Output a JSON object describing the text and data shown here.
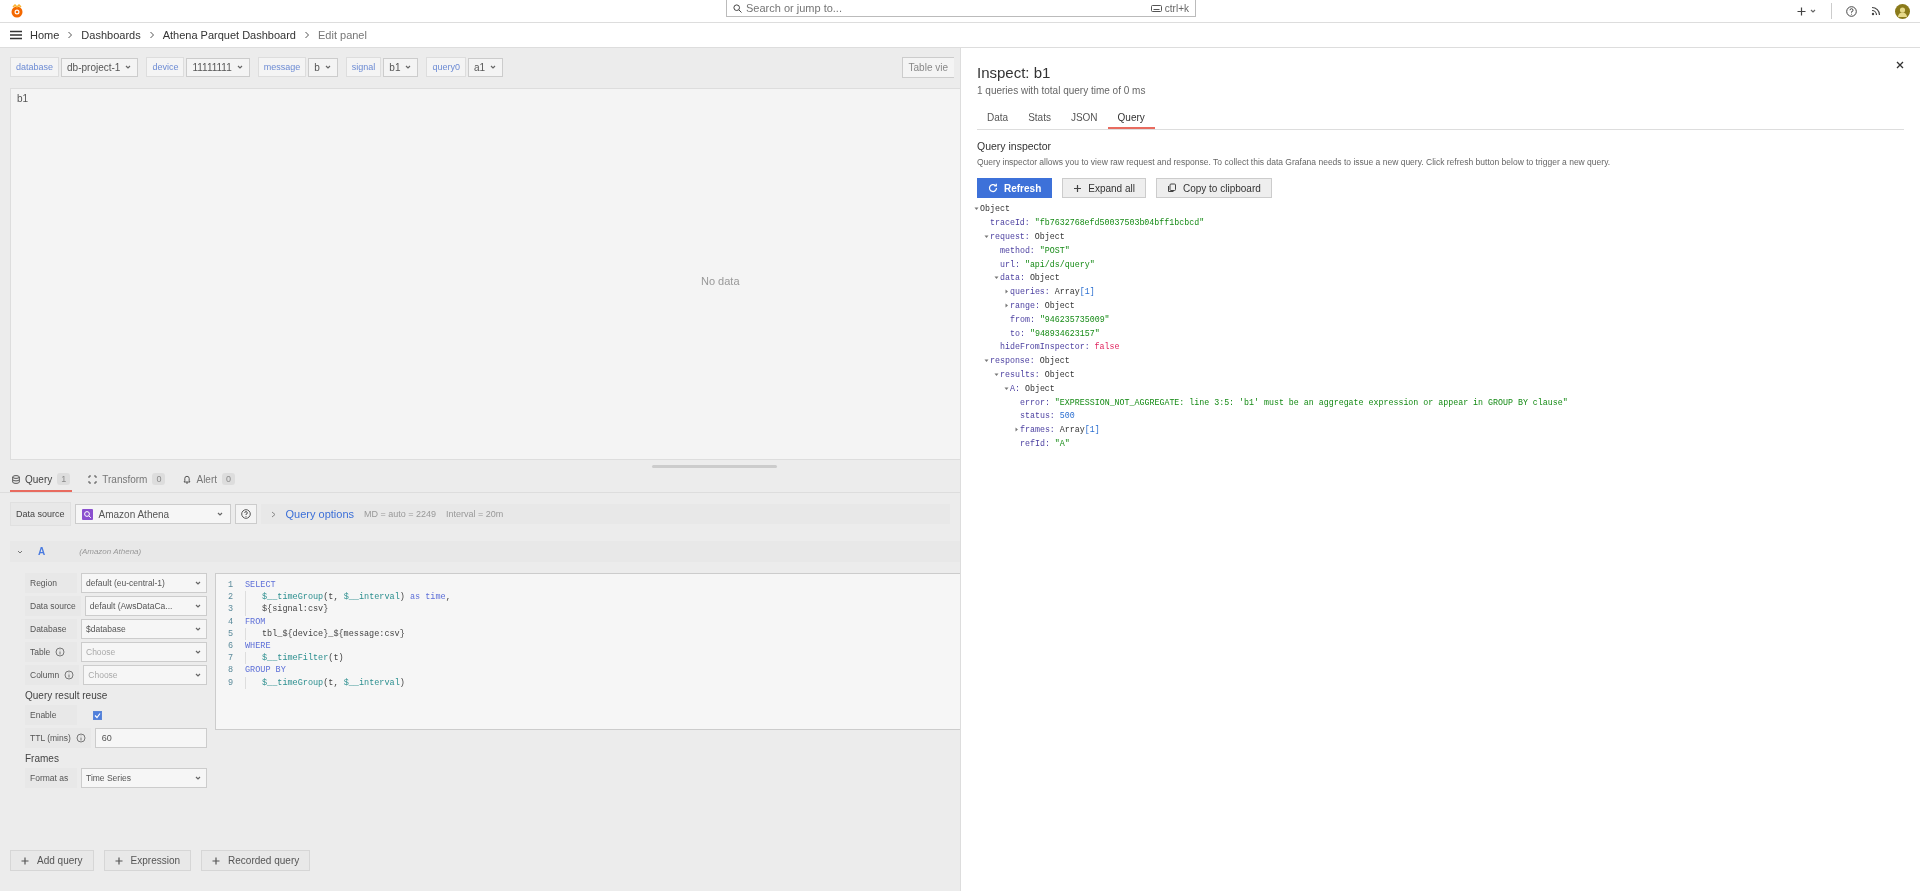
{
  "topbar": {
    "search_placeholder": "Search or jump to...",
    "shortcut": "ctrl+k"
  },
  "breadcrumbs": [
    "Home",
    "Dashboards",
    "Athena Parquet Dashboard",
    "Edit panel"
  ],
  "variables": [
    {
      "label": "database",
      "value": "db-project-1"
    },
    {
      "label": "device",
      "value": "11111111"
    },
    {
      "label": "message",
      "value": "b"
    },
    {
      "label": "signal",
      "value": "b1"
    },
    {
      "label": "query0",
      "value": "a1"
    }
  ],
  "view_toggle": "Table vie",
  "panel": {
    "title": "b1",
    "message": "No data"
  },
  "query_tabs": [
    {
      "label": "Query",
      "count": "1",
      "selected": true
    },
    {
      "label": "Transform",
      "count": "0",
      "selected": false
    },
    {
      "label": "Alert",
      "count": "0",
      "selected": false
    }
  ],
  "data_source": {
    "label": "Data source",
    "value": "Amazon Athena",
    "options_label": "Query options",
    "md": "MD = auto = 2249",
    "interval": "Interval = 20m"
  },
  "query": {
    "name": "A",
    "source": "(Amazon Athena)",
    "expanded": true
  },
  "fields": [
    {
      "kind": "select",
      "label": "Region",
      "value": "default (eu-central-1)"
    },
    {
      "kind": "select",
      "label": "Data source",
      "value": "default (AwsDataCa..."
    },
    {
      "kind": "select",
      "label": "Database",
      "value": "$database"
    },
    {
      "kind": "select",
      "label": "Table",
      "info": true,
      "placeholder": "Choose"
    },
    {
      "kind": "select",
      "label": "Column",
      "info": true,
      "placeholder": "Choose"
    },
    {
      "kind": "heading",
      "label": "Query result reuse"
    },
    {
      "kind": "checkbox",
      "label": "Enable",
      "checked": true
    },
    {
      "kind": "input",
      "label": "TTL (mins)",
      "info": true,
      "value": "60"
    },
    {
      "kind": "heading",
      "label": "Frames"
    },
    {
      "kind": "select",
      "label": "Format as",
      "value": "Time Series"
    }
  ],
  "code": [
    {
      "number": "1",
      "segments": [
        {
          "kind": "keyword",
          "text": "SELECT"
        }
      ]
    },
    {
      "number": "2",
      "indent": true,
      "segments": [
        {
          "kind": "macro",
          "text": "$__timeGroup"
        },
        {
          "kind": "plain",
          "text": "(t, "
        },
        {
          "kind": "macro",
          "text": "$__interval"
        },
        {
          "kind": "plain",
          "text": ") "
        },
        {
          "kind": "keyword",
          "text": "as time"
        },
        {
          "kind": "plain",
          "text": ","
        }
      ]
    },
    {
      "number": "3",
      "indent": true,
      "segments": [
        {
          "kind": "plain",
          "text": "${signal:csv}"
        }
      ]
    },
    {
      "number": "4",
      "segments": [
        {
          "kind": "keyword",
          "text": "FROM"
        }
      ]
    },
    {
      "number": "5",
      "indent": true,
      "segments": [
        {
          "kind": "plain",
          "text": "tbl_${device}_${message:csv}"
        }
      ]
    },
    {
      "number": "6",
      "segments": [
        {
          "kind": "keyword",
          "text": "WHERE"
        }
      ]
    },
    {
      "number": "7",
      "indent": true,
      "segments": [
        {
          "kind": "macro",
          "text": "$__timeFilter"
        },
        {
          "kind": "plain",
          "text": "(t)"
        }
      ]
    },
    {
      "number": "8",
      "segments": [
        {
          "kind": "keyword",
          "text": "GROUP BY"
        }
      ]
    },
    {
      "number": "9",
      "indent": true,
      "segments": [
        {
          "kind": "macro",
          "text": "$__timeGroup"
        },
        {
          "kind": "plain",
          "text": "(t, "
        },
        {
          "kind": "macro",
          "text": "$__interval"
        },
        {
          "kind": "plain",
          "text": ")"
        }
      ]
    }
  ],
  "add_buttons": [
    "Add query",
    "Expression",
    "Recorded query"
  ],
  "drawer": {
    "title": "Inspect: b1",
    "subtitle": "1 queries with total query time of 0 ms",
    "tabs": [
      {
        "label": "Data",
        "selected": false
      },
      {
        "label": "Stats",
        "selected": false
      },
      {
        "label": "JSON",
        "selected": false
      },
      {
        "label": "Query",
        "selected": true
      }
    ],
    "section_title": "Query inspector",
    "description": "Query inspector allows you to view raw request and response. To collect this data Grafana needs to issue a new query. Click refresh button below to trigger a new query.",
    "buttons": [
      {
        "kind": "refresh",
        "label": "Refresh"
      },
      {
        "kind": "expand",
        "label": "Expand all"
      },
      {
        "kind": "copy",
        "label": "Copy to clipboard"
      }
    ],
    "tree": {
      "value": "Object",
      "kind": "object",
      "expanded": true,
      "children": [
        {
          "key": "traceId:",
          "value": "\"fb7632768efd50037503b04bff1bcbcd\"",
          "kind": "string"
        },
        {
          "key": "request:",
          "value": "Object",
          "kind": "object",
          "expanded": true,
          "children": [
            {
              "key": "method:",
              "value": "\"POST\"",
              "kind": "string"
            },
            {
              "key": "url:",
              "value": "\"api/ds/query\"",
              "kind": "string"
            },
            {
              "key": "data:",
              "value": "Object",
              "kind": "object",
              "expanded": true,
              "children": [
                {
                  "key": "queries:",
                  "value": "Array",
                  "count": "[1]",
                  "kind": "object",
                  "expanded": false
                },
                {
                  "key": "range:",
                  "value": "Object",
                  "kind": "object",
                  "expanded": false
                },
                {
                  "key": "from:",
                  "value": "\"946235735009\"",
                  "kind": "string"
                },
                {
                  "key": "to:",
                  "value": "\"948934623157\"",
                  "kind": "string"
                }
              ]
            },
            {
              "key": "hideFromInspector:",
              "value": "false",
              "kind": "boolean"
            }
          ]
        },
        {
          "key": "response:",
          "value": "Object",
          "kind": "object",
          "expanded": true,
          "children": [
            {
              "key": "results:",
              "value": "Object",
              "kind": "object",
              "expanded": true,
              "children": [
                {
                  "key": "A:",
                  "value": "Object",
                  "kind": "object",
                  "expanded": true,
                  "children": [
                    {
                      "key": "error:",
                      "value": "\"EXPRESSION_NOT_AGGREGATE: line 3:5: 'b1' must be an aggregate expression or appear in GROUP BY clause\"",
                      "kind": "string"
                    },
                    {
                      "key": "status:",
                      "value": "500",
                      "kind": "number"
                    },
                    {
                      "key": "frames:",
                      "value": "Array",
                      "count": "[1]",
                      "kind": "object",
                      "expanded": false
                    },
                    {
                      "key": "refId:",
                      "value": "\"A\"",
                      "kind": "string"
                    }
                  ]
                }
              ]
            }
          ]
        }
      ]
    }
  }
}
